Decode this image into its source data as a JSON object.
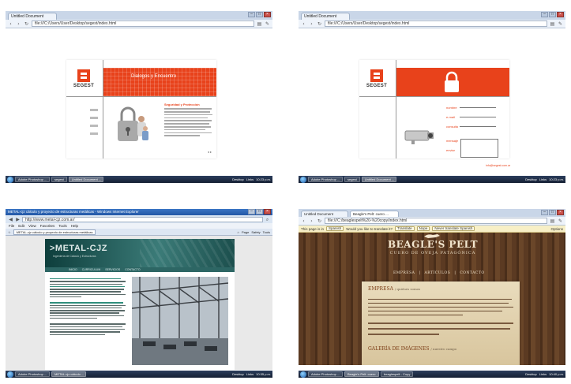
{
  "shots": {
    "top_left": {
      "tab_title": "Untitled Document",
      "url": "file:///C:/Users/User/Desktop/segest/index.html",
      "logo_text": "SEGEST",
      "banner_title": "Dialogos y Encuentro",
      "section_title": "Seguridad y Protección",
      "taskbar": [
        "Adobe Photoshop ...",
        "segest",
        "Untitled Document ..."
      ],
      "tray": [
        "Desktop",
        "Links",
        "10:23 p.m."
      ]
    },
    "top_right": {
      "tab_title": "Untitled Document",
      "url": "file:///C:/Users/User/Desktop/segest/index.html",
      "logo_text": "SEGEST",
      "form_labels": [
        "nombre",
        "e-mail",
        "consulta",
        "mensaje",
        "enviar"
      ],
      "footer": "info@segest.com.ar",
      "taskbar": [
        "Adobe Photoshop ...",
        "segest",
        "Untitled Document ..."
      ],
      "tray": [
        "Desktop",
        "Links",
        "10:23 p.m."
      ]
    },
    "bottom_left": {
      "window_title": "METAL-cjz cálculo y proyecto de estructuras metálicas - Windows Internet Explorer",
      "url": "http://www.metal-cjz.com.ar/",
      "menu": [
        "File",
        "Edit",
        "View",
        "Favorites",
        "Tools",
        "Help"
      ],
      "tab_title": "METAL-cjz cálculo y proyecto de estructuras metálicas",
      "toolbar": [
        "Page",
        "Safety",
        "Tools"
      ],
      "logo": ">METAL-CJZ",
      "logo_sub": "Ingeniería de Cálculo y Estructuras",
      "nav": [
        "INICIO",
        "CURRICULUM",
        "SERVICIOS",
        "CONTACTO"
      ],
      "taskbar": [
        "Adobe Photoshop ...",
        "METAL-cjz cálculo ..."
      ],
      "tray": [
        "Desktop",
        "Links",
        "10:35 p.m."
      ]
    },
    "bottom_right": {
      "tabs": [
        "Untitled Document",
        "Beagle's Pelt: cuero ..."
      ],
      "url": "file:///C:/beaglespelt%20-%20copy/index.html",
      "translate_bar": {
        "prefix": "This page is in",
        "language": "Spanish",
        "question": "Would you like to translate it?",
        "translate_btn": "Translate",
        "nope_btn": "Nope",
        "never_btn": "Never translate Spanish",
        "options": "Options"
      },
      "site_title": "BEAGLE'S PELT",
      "site_subtitle": "CUERO DE OVEJA PATAGÓNICA",
      "nav": [
        "EMPRESA",
        "ARTÍCULOS",
        "CONTACTO"
      ],
      "section_heading": "EMPRESA",
      "section_heading_sub": "/ quiénes somos",
      "gallery_heading": "GALERÍA DE IMÁGENES",
      "gallery_sub": "/ nuestro campo",
      "taskbar": [
        "Adobe Photoshop ...",
        "Beagle's Pelt: cuero ...",
        "beaglespelt - Copy"
      ],
      "tray": [
        "Desktop",
        "Links",
        "10:40 p.m."
      ]
    }
  },
  "colors": {
    "segest_red": "#e8421b",
    "metal_teal": "#2d6664",
    "leather_brown": "#5b3a22",
    "parchment": "#e9dcbd"
  }
}
